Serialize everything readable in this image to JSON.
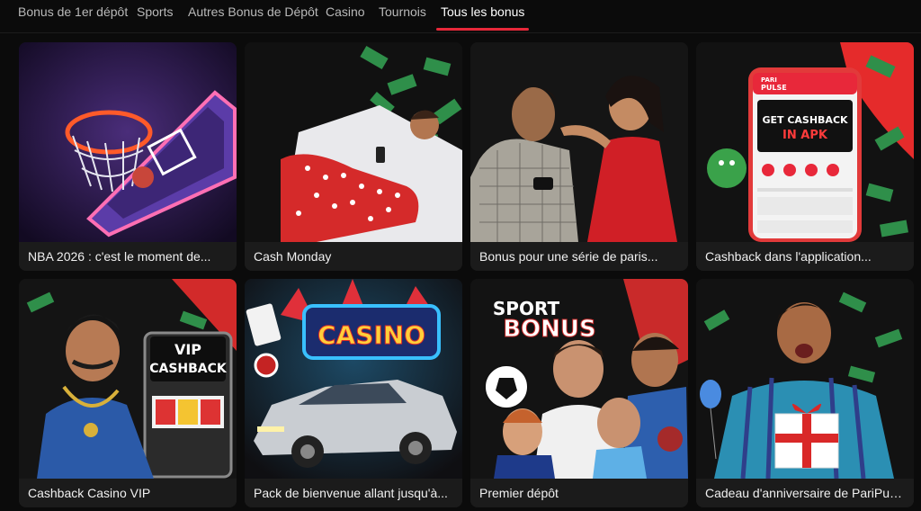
{
  "tabs": [
    {
      "label": "Bonus de 1er dépôt",
      "active": false
    },
    {
      "label": "Sports",
      "active": false
    },
    {
      "label": "Autres Bonus de Dépôt",
      "active": false
    },
    {
      "label": "Casino",
      "active": false
    },
    {
      "label": "Tournois",
      "active": false
    },
    {
      "label": "Tous les bonus",
      "active": true
    }
  ],
  "accent_color": "#e8283a",
  "cards": [
    {
      "title": "NBA 2026 : c'est le moment de...",
      "image": "basketball-hoop-illustration"
    },
    {
      "title": "Cash Monday",
      "image": "man-in-polka-dot-pajamas-illustration"
    },
    {
      "title": "Bonus pour une série de paris...",
      "image": "couple-with-phone-illustration"
    },
    {
      "title": "Cashback dans l'application...",
      "image": "phone-app-cashback-illustration",
      "art_text": {
        "headline_1": "GET CASHBACK",
        "headline_2": "IN APK",
        "brand_1": "PARI",
        "brand_2": "PULSE"
      }
    },
    {
      "title": "Cashback Casino VIP",
      "image": "vip-slot-machine-illustration",
      "art_text": {
        "line_1": "VIP",
        "line_2": "CASHBACK"
      }
    },
    {
      "title": "Pack de bienvenue allant jusqu'à...",
      "image": "casino-car-illustration",
      "art_text": {
        "sign": "CASINO"
      }
    },
    {
      "title": "Premier dépôt",
      "image": "sport-bonus-players-illustration",
      "art_text": {
        "line_1": "SPORT",
        "line_2": "BONUS"
      }
    },
    {
      "title": "Cadeau d'anniversaire de PariPulse",
      "image": "man-with-gift-illustration"
    }
  ]
}
